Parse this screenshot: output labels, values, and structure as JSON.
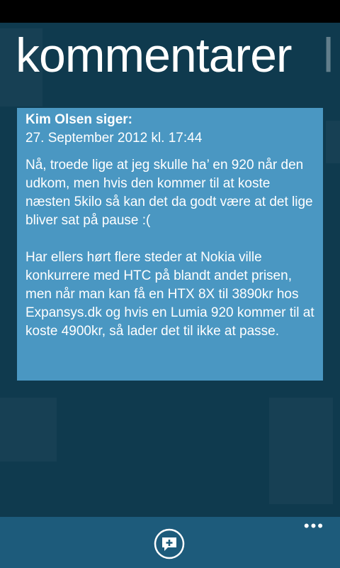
{
  "header": {
    "title": "kommentarer",
    "next_pivot_peek": "l"
  },
  "comment": {
    "author": "Kim Olsen siger:",
    "date": "27. September 2012 kl. 17:44",
    "paragraphs": [
      "Nå, troede lige at jeg skulle ha’ en 920 når den udkom, men hvis den kommer til at koste næsten 5kilo så kan det da godt være at det lige bliver sat på pause :(",
      "Har ellers hørt flere steder at Nokia ville konkurrere med HTC på blandt andet prisen, men når man kan få en HTX 8X til 3890kr hos Expansys.dk og hvis en Lumia 920 kommer til at koste 4900kr, så lader det til ikke at passe."
    ]
  },
  "app_bar": {
    "add_comment_icon": "comment-add-icon",
    "more_label": "•••"
  },
  "colors": {
    "background": "#0f3a4e",
    "card": "#4a97c2",
    "app_bar": "#1d5b7b"
  }
}
